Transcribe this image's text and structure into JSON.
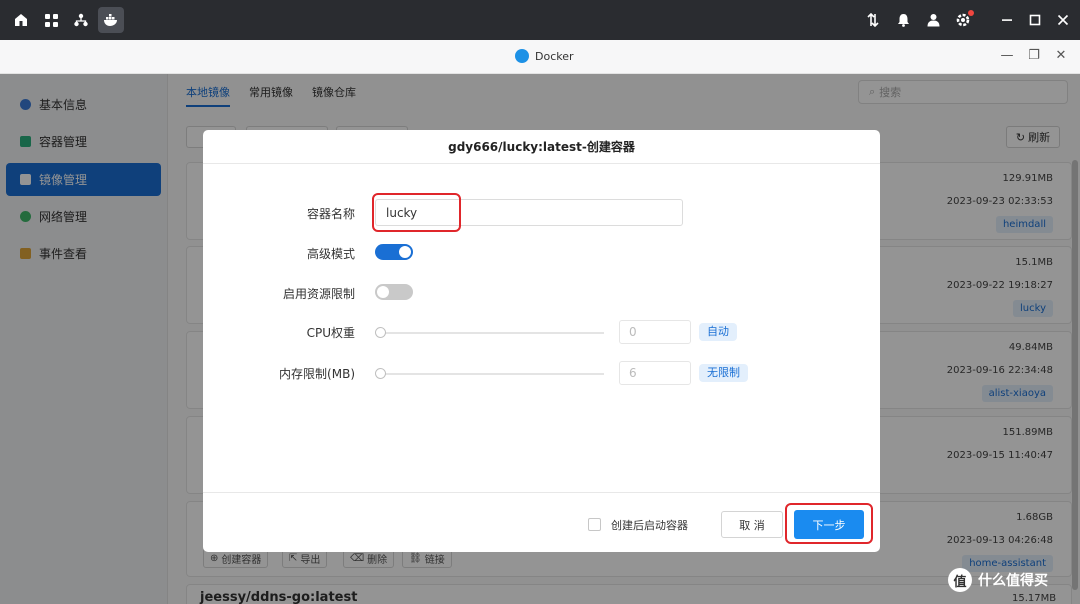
{
  "taskbar": {
    "icons": [
      "home-icon",
      "apps-grid-icon",
      "network-icon",
      "docker-icon"
    ],
    "right_icons": [
      "transfer-icon",
      "bell-icon",
      "user-icon",
      "settings-icon"
    ],
    "window_controls": [
      "minimize-icon",
      "maximize-icon",
      "close-icon"
    ]
  },
  "window": {
    "title": "Docker",
    "controls": [
      "minimize-icon",
      "restore-icon",
      "close-icon"
    ]
  },
  "sidebar": {
    "items": [
      {
        "label": "基本信息",
        "color": "#3b7bd8"
      },
      {
        "label": "容器管理",
        "color": "#2bb07f"
      },
      {
        "label": "镜像管理",
        "color": "#ffffff",
        "active": true
      },
      {
        "label": "网络管理",
        "color": "#3fb86a"
      },
      {
        "label": "事件查看",
        "color": "#e0a63a"
      }
    ]
  },
  "tabs": [
    "本地镜像",
    "常用镜像",
    "镜像仓库"
  ],
  "search": {
    "placeholder": "搜索"
  },
  "refresh_label": "刷新",
  "images": [
    {
      "size": "129.91MB",
      "date": "2023-09-23 02:33:53",
      "tag": "heimdall"
    },
    {
      "size": "15.1MB",
      "date": "2023-09-22 19:18:27",
      "tag": "lucky"
    },
    {
      "size": "49.84MB",
      "date": "2023-09-16 22:34:48",
      "tag": "alist-xiaoya"
    },
    {
      "size": "151.89MB",
      "date": "2023-09-15 11:40:47",
      "tag": ""
    },
    {
      "size": "1.68GB",
      "date": "2023-09-13 04:26:48",
      "tag": "home-assistant"
    }
  ],
  "card_actions": [
    "创建容器",
    "导出",
    "删除",
    "链接"
  ],
  "next_card": {
    "title": "jeessy/ddns-go:latest",
    "size": "15.17MB"
  },
  "modal": {
    "title": "gdy666/lucky:latest-创建容器",
    "labels": {
      "name": "容器名称",
      "advanced": "高级模式",
      "resource_limit": "启用资源限制",
      "cpu": "CPU权重",
      "memory": "内存限制(MB)"
    },
    "name_value": "lucky",
    "advanced_on": true,
    "resource_limit_on": false,
    "cpu_value": "0",
    "cpu_unit": "自动",
    "memory_value": "6",
    "memory_unit": "无限制",
    "start_after_create": "创建后启动容器",
    "cancel": "取 消",
    "next": "下一步"
  },
  "watermark": {
    "mark": "值",
    "text": "什么值得买"
  }
}
